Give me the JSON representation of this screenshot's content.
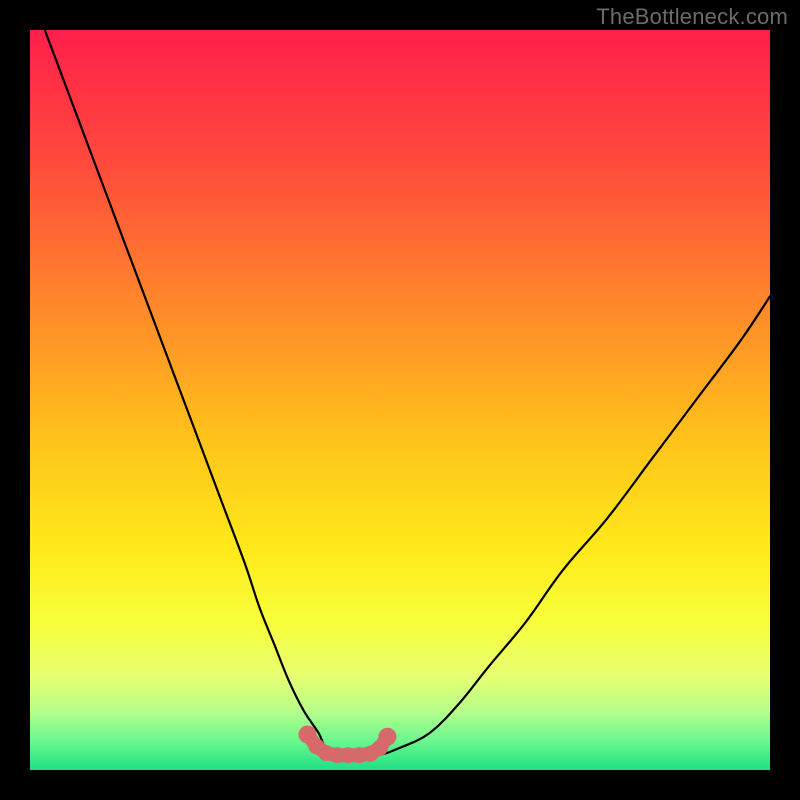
{
  "watermark": {
    "text": "TheBottleneck.com"
  },
  "colors": {
    "background": "#000000",
    "curve": "#000000",
    "marker": "#d66a6a",
    "gradient_stops": [
      {
        "pct": 0,
        "color": "#ff1f4b"
      },
      {
        "pct": 18,
        "color": "#ff4a3c"
      },
      {
        "pct": 38,
        "color": "#ff8a2a"
      },
      {
        "pct": 55,
        "color": "#ffc21a"
      },
      {
        "pct": 70,
        "color": "#ffe91a"
      },
      {
        "pct": 80,
        "color": "#f7ff3a"
      },
      {
        "pct": 87,
        "color": "#e8ff70"
      },
      {
        "pct": 92,
        "color": "#b7ff8a"
      },
      {
        "pct": 96,
        "color": "#6cf78f"
      },
      {
        "pct": 100,
        "color": "#1fe083"
      }
    ]
  },
  "chart_data": {
    "type": "line",
    "title": "",
    "xlabel": "",
    "ylabel": "",
    "xlim": [
      0,
      100
    ],
    "ylim": [
      0,
      100
    ],
    "grid": false,
    "legend": false,
    "series": [
      {
        "name": "bottleneck-curve",
        "x": [
          2,
          5,
          8,
          11,
          14,
          17,
          20,
          23,
          26,
          29,
          31,
          33,
          35,
          37,
          39,
          40,
          42,
          44,
          47,
          50,
          54,
          58,
          62,
          67,
          72,
          78,
          84,
          90,
          96,
          100
        ],
        "y": [
          100,
          92,
          84,
          76,
          68,
          60,
          52,
          44,
          36,
          28,
          22,
          17,
          12,
          8,
          5,
          3,
          2,
          2,
          2,
          3,
          5,
          9,
          14,
          20,
          27,
          34,
          42,
          50,
          58,
          64
        ]
      }
    ],
    "markers": {
      "name": "bottom-region",
      "x": [
        37.5,
        38.7,
        40.0,
        41.5,
        43.0,
        44.5,
        46.0,
        47.3,
        48.3
      ],
      "y": [
        4.8,
        3.2,
        2.3,
        2.0,
        2.0,
        2.0,
        2.2,
        3.0,
        4.5
      ]
    }
  }
}
